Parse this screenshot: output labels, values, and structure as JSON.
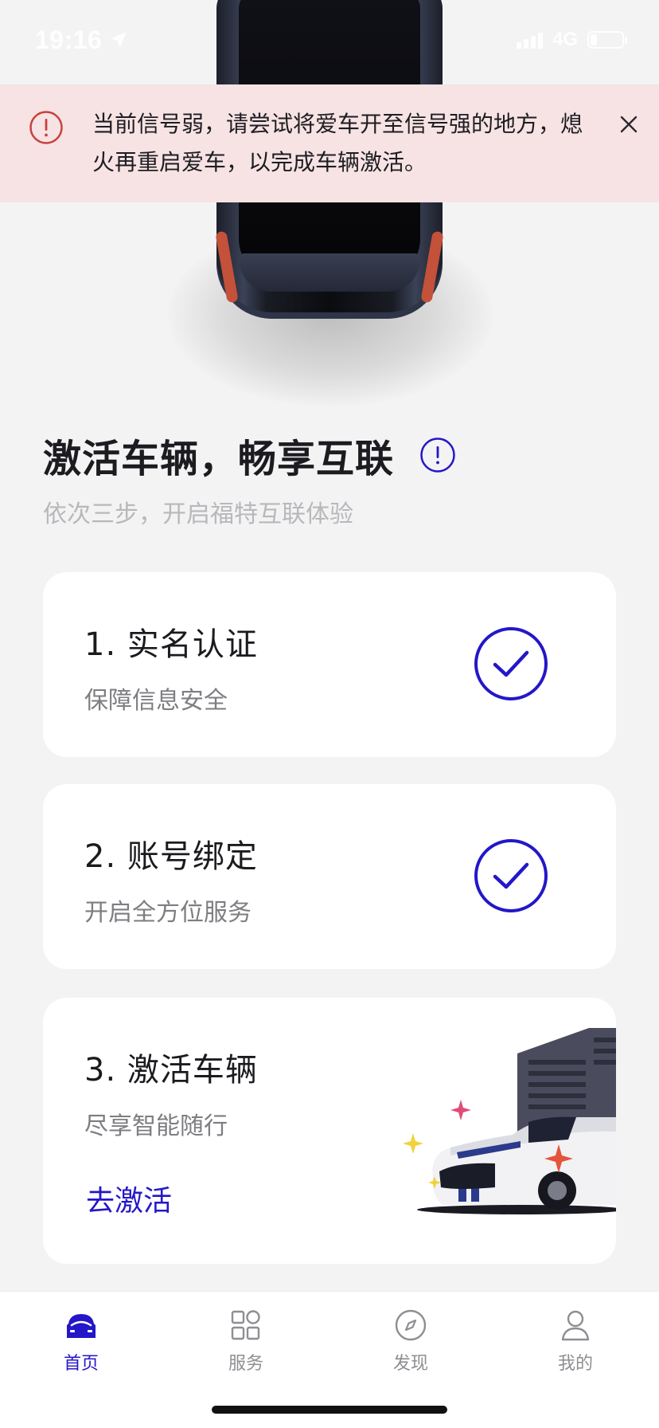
{
  "status_bar": {
    "time": "19:16",
    "network": "4G"
  },
  "alert": {
    "message": "当前信号弱，请尝试将爱车开至信号强的地方，熄火再重启爱车，以完成车辆激活。"
  },
  "header": {
    "title": "激活车辆，畅享互联",
    "subtitle": "依次三步，开启福特互联体验"
  },
  "steps": [
    {
      "title": "1. 实名认证",
      "description": "保障信息安全",
      "completed": true
    },
    {
      "title": "2. 账号绑定",
      "description": "开启全方位服务",
      "completed": true
    },
    {
      "title": "3. 激活车辆",
      "description": "尽享智能随行",
      "completed": false,
      "action_label": "去激活"
    }
  ],
  "tabs": [
    {
      "label": "首页",
      "icon": "car-icon",
      "active": true
    },
    {
      "label": "服务",
      "icon": "grid-icon",
      "active": false
    },
    {
      "label": "发现",
      "icon": "compass-icon",
      "active": false
    },
    {
      "label": "我的",
      "icon": "person-icon",
      "active": false
    }
  ],
  "colors": {
    "accent": "#2417c8",
    "alert_background": "#f7e3e4",
    "alert_icon": "#c8423e",
    "page_background": "#f3f3f4"
  }
}
